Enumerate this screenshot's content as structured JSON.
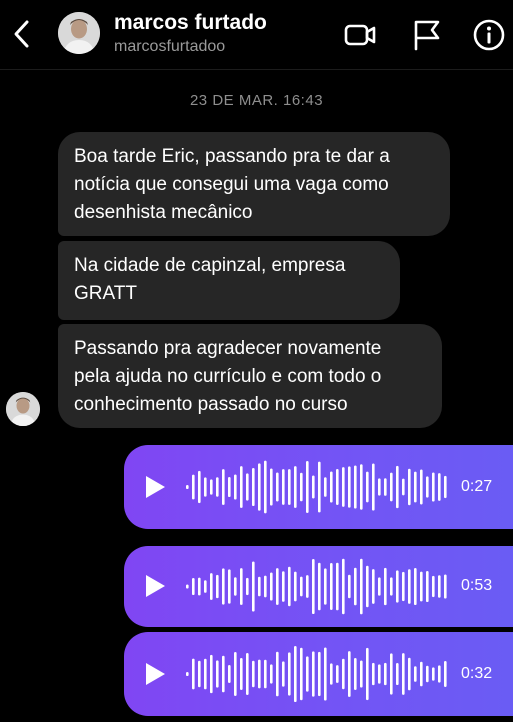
{
  "header": {
    "name": "marcos furtado",
    "handle": "marcosfurtadoo"
  },
  "timestamp": "23 DE MAR. 16:43",
  "messages": [
    {
      "lines": [
        "Boa tarde Eric, passando pra te dar a",
        "notícia que consegui uma vaga como",
        "desenhista mecânico"
      ]
    },
    {
      "lines": [
        "Na cidade de capinzal, empresa",
        "GRATT"
      ]
    },
    {
      "lines": [
        "Passando pra agradecer novamente",
        "pela ajuda no currículo e com todo o",
        "conhecimento passado no curso"
      ]
    }
  ],
  "audio_messages": [
    {
      "duration": "0:27"
    },
    {
      "duration": "0:53"
    },
    {
      "duration": "0:32"
    }
  ],
  "icons": {
    "back": "chevron-left-icon",
    "video": "video-camera-icon",
    "report": "flag-icon",
    "info": "info-icon",
    "play": "play-icon"
  },
  "colors": {
    "background": "#000000",
    "incoming_bubble": "#262626",
    "audio_gradient_start": "#8046f3",
    "audio_gradient_end": "#6a5cf4",
    "muted_text": "#8e8e8e"
  }
}
